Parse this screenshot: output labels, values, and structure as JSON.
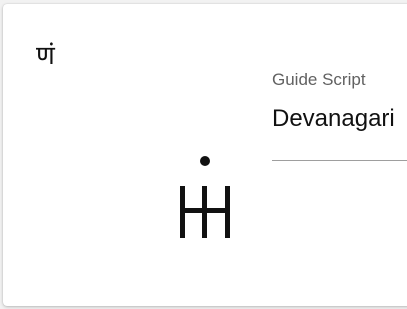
{
  "card": {
    "source_character": "णं",
    "glyph_icon": "transliterated-glyph-h-dot"
  },
  "guide": {
    "label": "Guide Script",
    "selected_value": "Devanagari"
  }
}
